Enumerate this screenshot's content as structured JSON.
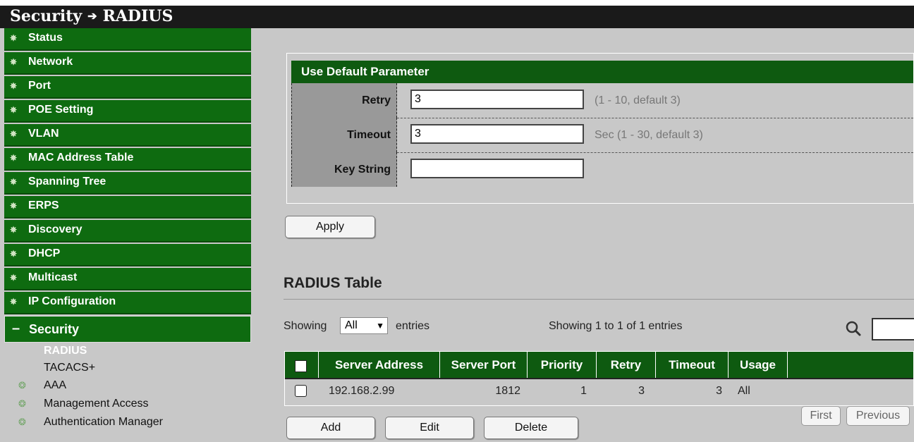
{
  "title": {
    "section": "Security",
    "arrow": "➔",
    "page": "RADIUS"
  },
  "sidebar": {
    "items": [
      {
        "label": "Status"
      },
      {
        "label": "Network"
      },
      {
        "label": "Port"
      },
      {
        "label": "POE Setting"
      },
      {
        "label": "VLAN"
      },
      {
        "label": "MAC Address Table"
      },
      {
        "label": "Spanning Tree"
      },
      {
        "label": "ERPS"
      },
      {
        "label": "Discovery"
      },
      {
        "label": "DHCP"
      },
      {
        "label": "Multicast"
      },
      {
        "label": "IP Configuration"
      }
    ],
    "expanded": {
      "label": "Security",
      "marker": "–"
    },
    "sub_items": [
      {
        "label": "RADIUS"
      },
      {
        "label": "TACACS+"
      }
    ],
    "sub_categories": [
      {
        "label": "AAA"
      },
      {
        "label": "Management Access"
      },
      {
        "label": "Authentication Manager"
      }
    ]
  },
  "params": {
    "header": "Use Default Parameter",
    "retry": {
      "label": "Retry",
      "value": "3",
      "hint": "(1 - 10, default 3)"
    },
    "timeout": {
      "label": "Timeout",
      "value": "3",
      "hint": "Sec (1 - 30, default 3)"
    },
    "key_string": {
      "label": "Key String",
      "value": ""
    },
    "apply_label": "Apply"
  },
  "table_section": {
    "title": "RADIUS Table",
    "showing_label": "Showing",
    "entries_select": "All",
    "entries_label": "entries",
    "info": "Showing 1 to 1 of 1 entries",
    "columns": [
      "Server Address",
      "Server Port",
      "Priority",
      "Retry",
      "Timeout",
      "Usage"
    ],
    "rows": [
      {
        "server_address": "192.168.2.99",
        "server_port": "1812",
        "priority": "1",
        "retry": "3",
        "timeout": "3",
        "usage": "All"
      }
    ],
    "buttons": {
      "add": "Add",
      "edit": "Edit",
      "delete": "Delete"
    },
    "pagination": {
      "first": "First",
      "previous": "Previous"
    }
  },
  "colors": {
    "menu_green": "#0e6b10",
    "header_green": "#0e5a10",
    "panel_gray": "#c8c8c8",
    "titlebar": "#1a1a1a"
  }
}
